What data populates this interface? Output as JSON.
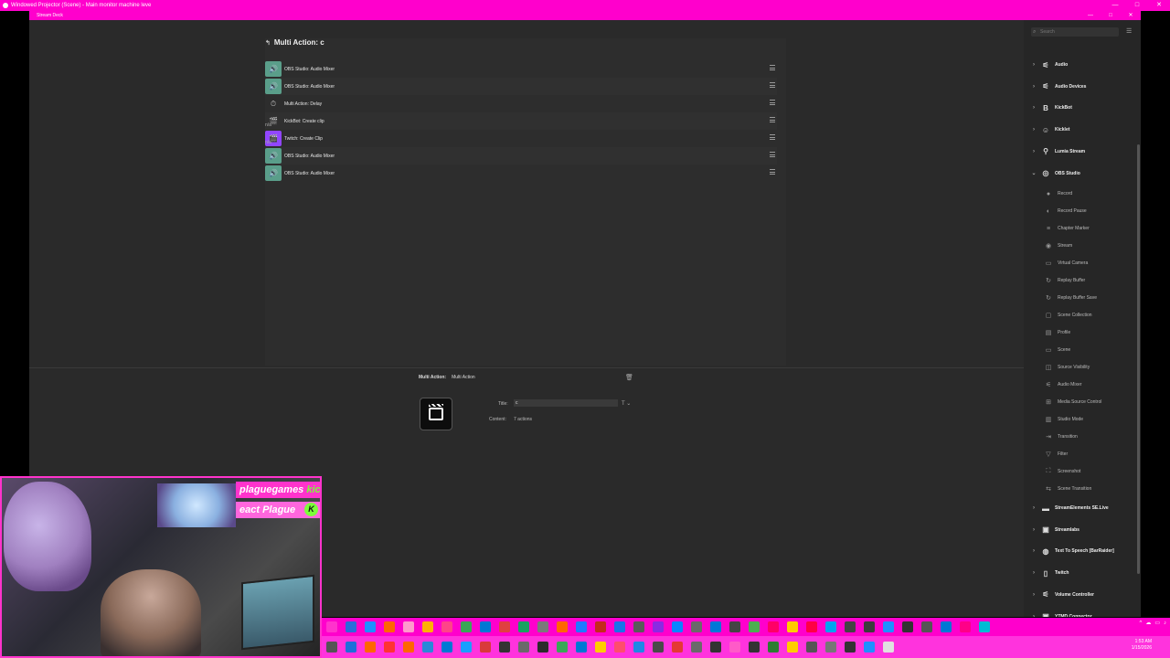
{
  "projector": {
    "title": "Windowed Projector (Scene) - Main monitor machine leve",
    "controls": [
      "—",
      "□",
      "✕"
    ]
  },
  "app": {
    "title": "Stream Deck",
    "controls": [
      "—",
      "□",
      "✕"
    ]
  },
  "editor": {
    "back_glyph": "↰",
    "title": "Multi Action: c",
    "actions": [
      {
        "type": "obs",
        "icon": "🔊",
        "name": "OBS Studio: Audio Mixer",
        "sub": ""
      },
      {
        "type": "obs",
        "icon": "🔊",
        "name": "OBS Studio: Audio Mixer",
        "sub": ""
      },
      {
        "type": "delay",
        "icon": "⏱",
        "name": "Multi Action: Delay",
        "sub": ""
      },
      {
        "type": "kick",
        "icon": "🎬",
        "name": "KickBot: Create clip",
        "sub": "n/a"
      },
      {
        "type": "twitch",
        "icon": "🎬",
        "name": "Twitch: Create Clip",
        "sub": "n/a"
      },
      {
        "type": "obs",
        "icon": "🔊",
        "name": "OBS Studio: Audio Mixer",
        "sub": ""
      },
      {
        "type": "obs",
        "icon": "🔊",
        "name": "OBS Studio: Audio Mixer",
        "sub": ""
      }
    ]
  },
  "inspector": {
    "label": "Multi Action:",
    "value": "Multi Action",
    "trash_icon": "🗑",
    "title_label": "Title:",
    "title_value": "c",
    "title_format": "T ⌄",
    "content_label": "Content:",
    "content_value": "7 actions"
  },
  "sidebar": {
    "search_placeholder": "Search",
    "categories": [
      {
        "label": "Audio",
        "icon": "⚟",
        "expanded": false
      },
      {
        "label": "Audio Devices",
        "icon": "⚟",
        "expanded": false
      },
      {
        "label": "KickBot",
        "icon": "B",
        "expanded": false
      },
      {
        "label": "Kicklet",
        "icon": "☺",
        "expanded": false
      },
      {
        "label": "Lumia Stream",
        "icon": "⚲",
        "expanded": false
      },
      {
        "label": "OBS Studio",
        "icon": "◎",
        "expanded": true
      }
    ],
    "obs_items": [
      {
        "label": "Record",
        "icon": "●"
      },
      {
        "label": "Record Pause",
        "icon": "◐"
      },
      {
        "label": "Chapter Marker",
        "icon": "≡"
      },
      {
        "label": "Stream",
        "icon": "◉"
      },
      {
        "label": "Virtual Camera",
        "icon": "▭"
      },
      {
        "label": "Replay Buffer",
        "icon": "↻"
      },
      {
        "label": "Replay Buffer Save",
        "icon": "↻"
      },
      {
        "label": "Scene Collection",
        "icon": "▢"
      },
      {
        "label": "Profile",
        "icon": "▤"
      },
      {
        "label": "Scene",
        "icon": "▭"
      },
      {
        "label": "Source Visibility",
        "icon": "◫"
      },
      {
        "label": "Audio Mixer",
        "icon": "⚟"
      },
      {
        "label": "Media Source Control",
        "icon": "⊞"
      },
      {
        "label": "Studio Mode",
        "icon": "▥"
      },
      {
        "label": "Transition",
        "icon": "⇥"
      },
      {
        "label": "Filter",
        "icon": "▽"
      },
      {
        "label": "Screenshot",
        "icon": "⛶"
      },
      {
        "label": "Scene Transition",
        "icon": "⇆"
      }
    ],
    "more_categories": [
      {
        "label": "StreamElements SE.Live",
        "icon": "▬"
      },
      {
        "label": "Streamlabs",
        "icon": "▣"
      },
      {
        "label": "Text To Speech [BarRaider]",
        "icon": "◍"
      },
      {
        "label": "Twitch",
        "icon": "▯"
      },
      {
        "label": "Volume Controller",
        "icon": "⚟"
      },
      {
        "label": "YTMD Connector",
        "icon": "▣"
      }
    ]
  },
  "webcam": {
    "line1_white": "plaguegames",
    "line1_green": "kic",
    "line2": "eact Plague",
    "badge": "K"
  },
  "taskbar": {
    "clock_time": "1:53 AM",
    "clock_date": "1/15/2026",
    "top_colors": [
      "#ff33cc",
      "#2b6cd9",
      "#1e90ff",
      "#ff6600",
      "#ff99cc",
      "#ffb000",
      "#ff4488",
      "#3aa757",
      "#0078d4",
      "#e04040",
      "#1aa260",
      "#7a7a7a",
      "#ff6600",
      "#1f7aff",
      "#c42b1c",
      "#1a73e8",
      "#5a5a5a",
      "#8a2be2",
      "#0a84ff",
      "#6a6a6a",
      "#0078d7",
      "#444",
      "#4caf50",
      "#ff0066",
      "#ffcc00",
      "#ff0044",
      "#00a4ef",
      "#444",
      "#3c3c3c",
      "#1e90ff",
      "#333",
      "#555",
      "#0078d4",
      "#ff0088",
      "#00bcd4"
    ],
    "bottom_colors": [
      "#555",
      "#1e6fd9",
      "#ff6600",
      "#ff3333",
      "#ff6600",
      "#2b88d8",
      "#0078d4",
      "#1a9fff",
      "#d93a3a",
      "#333",
      "#6a6a6a",
      "#2c2c2c",
      "#3aa757",
      "#0078d4",
      "#ffcc00",
      "#ff4d6d",
      "#1e88e5",
      "#4a4a4a",
      "#e53935",
      "#6a6a6a",
      "#333",
      "#ff5ac8",
      "#333",
      "#2e7d32",
      "#ffcc00",
      "#555",
      "#777",
      "#333",
      "#1e90ff",
      "#e0e0e0"
    ]
  }
}
